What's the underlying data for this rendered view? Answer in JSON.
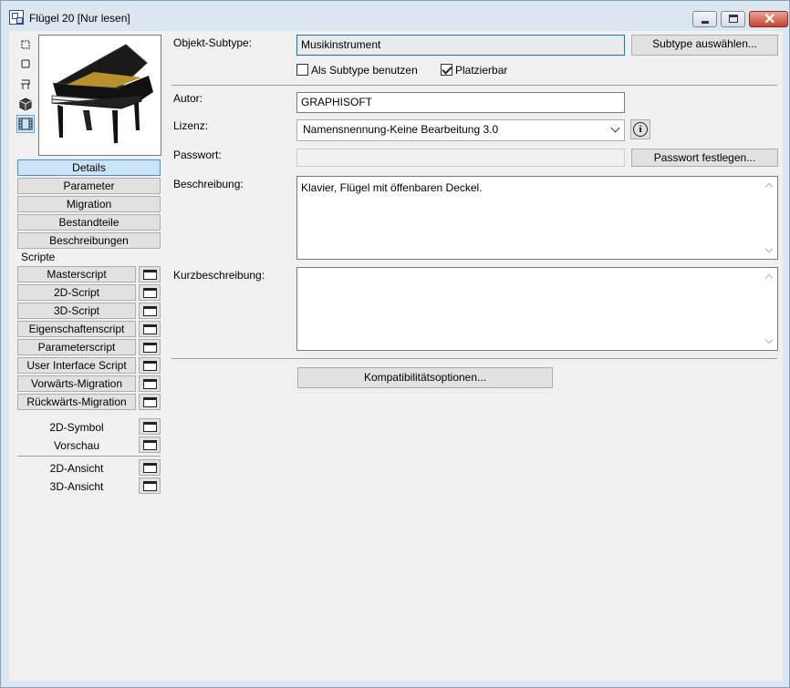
{
  "window": {
    "title": "Flügel 20 [Nur lesen]"
  },
  "left_icons": [
    "2d-symbol-icon",
    "2d-view-icon",
    "table-icon",
    "3d-cube-icon",
    "film-strip-icon"
  ],
  "nav": {
    "buttons": [
      "Details",
      "Parameter",
      "Migration",
      "Bestandteile",
      "Beschreibungen"
    ],
    "selected": "Details",
    "scripts_label": "Scripte",
    "scripts": [
      "Masterscript",
      "2D-Script",
      "3D-Script",
      "Eigenschaftenscript",
      "Parameterscript",
      "User Interface Script",
      "Vorwärts-Migration",
      "Rückwärts-Migration"
    ],
    "views_a": [
      "2D-Symbol",
      "Vorschau"
    ],
    "views_b": [
      "2D-Ansicht",
      "3D-Ansicht"
    ]
  },
  "details": {
    "subtype_label": "Objekt-Subtype:",
    "subtype_value": "Musikinstrument",
    "subtype_button": "Subtype auswählen...",
    "use_as_subtype_label": "Als Subtype benutzen",
    "use_as_subtype_checked": false,
    "placeable_label": "Platzierbar",
    "placeable_checked": true,
    "author_label": "Autor:",
    "author_value": "GRAPHISOFT",
    "license_label": "Lizenz:",
    "license_value": "Namensnennung-Keine Bearbeitung 3.0",
    "password_label": "Passwort:",
    "password_value": "",
    "password_button": "Passwort festlegen...",
    "description_label": "Beschreibung:",
    "description_value": "Klavier, Flügel mit öffenbaren Deckel.",
    "short_description_label": "Kurzbeschreibung:",
    "short_description_value": "",
    "compat_button": "Kompatibilitätsoptionen..."
  },
  "colors": {
    "accent": "#0078d7",
    "selection": "#cce4f7",
    "titlebar": "#dce6f1"
  }
}
